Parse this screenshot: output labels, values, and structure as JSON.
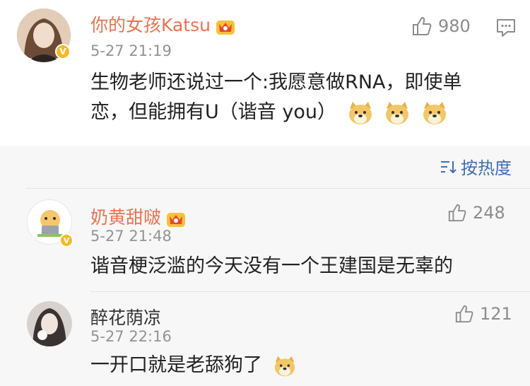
{
  "main_comment": {
    "username": "你的女孩Katsu",
    "time": "5-27 21:19",
    "likes": "980",
    "text_line1": "生物老师还说过一个:我愿意做RNA，即使单",
    "text_line2": "恋，但能拥有U（谐音 you）"
  },
  "sort": {
    "label": "按热度"
  },
  "replies": [
    {
      "username": "奶黄甜啵",
      "time": "5-27 21:48",
      "likes": "248",
      "text": "谐音梗泛滥的今天没有一个王建国是无辜的"
    },
    {
      "username": "醉花荫凉",
      "time": "5-27 22:16",
      "likes": "121",
      "text": "一开口就是老舔狗了"
    }
  ],
  "colors": {
    "username": "#eb7350",
    "sort": "#3f6fb3",
    "muted": "#939393",
    "badge": "#f8b826"
  }
}
